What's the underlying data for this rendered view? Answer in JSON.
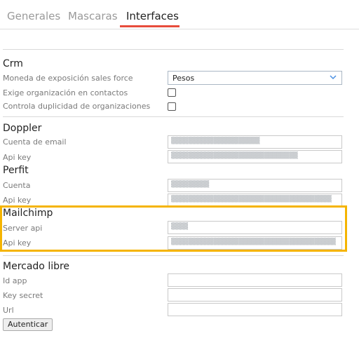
{
  "tabs": [
    "Generales",
    "Mascaras",
    "Interfaces"
  ],
  "crm": {
    "title": "Crm",
    "currency_label": "Moneda de exposición sales force",
    "currency_value": "Pesos",
    "require_org_label": "Exige organización en contactos",
    "dup_org_label": "Controla duplicidad de organizaciones"
  },
  "doppler": {
    "title": "Doppler",
    "email_label": "Cuenta de email",
    "api_label": "Api key",
    "email_masked": "▒▒▒▒▒▒▒▒▒▒▒▒▒▒▒▒▒▒▒▒▒",
    "api_masked": "▒▒▒▒▒▒▒▒▒▒▒▒▒▒▒▒▒▒▒▒▒▒▒▒▒▒▒▒▒▒"
  },
  "perfit": {
    "title": "Perfit",
    "account_label": "Cuenta",
    "api_label": "Api key",
    "account_masked": "▒▒▒▒▒▒▒▒▒",
    "api_masked": "▒▒▒▒▒▒▒▒▒▒▒▒▒▒▒▒▒▒▒▒▒▒▒▒▒▒▒▒▒▒▒▒▒▒▒▒▒▒"
  },
  "mailchimp": {
    "title": "Mailchimp",
    "server_label": "Server api",
    "api_label": "Api key",
    "server_masked": "▒▒▒▒",
    "api_masked": "▒▒▒▒▒▒▒▒▒▒▒▒▒▒▒▒▒▒▒▒▒▒▒▒▒▒▒▒▒▒▒▒▒▒▒▒▒▒▒"
  },
  "mercado": {
    "title": "Mercado libre",
    "id_label": "Id app",
    "secret_label": "Key secret",
    "url_label": "Url",
    "auth_button": "Autenticar"
  },
  "colors": {
    "accent": "#e74c3c",
    "highlight": "#f5b400"
  }
}
